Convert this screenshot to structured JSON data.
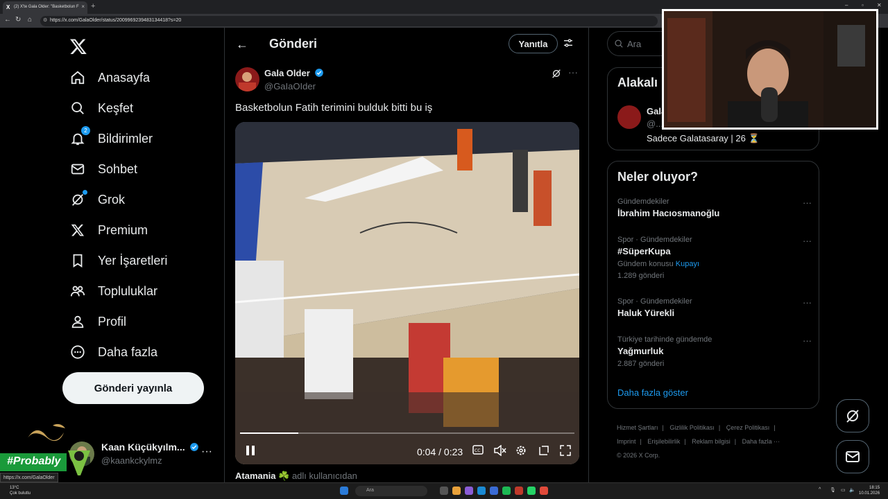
{
  "browser": {
    "tab_title": "(2) X'te Gala Older: \"Basketbolun F",
    "tab_close": "×",
    "new_tab": "+",
    "url": "https://x.com/GalaOlder/status/2009969239483134418?s=20",
    "status_url": "https://x.com/GalaOlder"
  },
  "nav": {
    "items": [
      {
        "label": "Anasayfa",
        "icon": "home-icon"
      },
      {
        "label": "Keşfet",
        "icon": "search-icon"
      },
      {
        "label": "Bildirimler",
        "icon": "bell-icon",
        "badge": "2"
      },
      {
        "label": "Sohbet",
        "icon": "mail-icon"
      },
      {
        "label": "Grok",
        "icon": "grok-icon"
      },
      {
        "label": "Premium",
        "icon": "x-icon"
      },
      {
        "label": "Yer İşaretleri",
        "icon": "bookmark-icon"
      },
      {
        "label": "Topluluklar",
        "icon": "communities-icon"
      },
      {
        "label": "Profil",
        "icon": "profile-icon"
      },
      {
        "label": "Daha fazla",
        "icon": "more-circle-icon"
      }
    ],
    "post_button": "Gönderi yayınla"
  },
  "account": {
    "name": "Kaan Küçükyılm...",
    "handle": "@kaankckylmz",
    "more": "···"
  },
  "overlay": {
    "probably": "#Probably"
  },
  "main": {
    "back": "←",
    "title": "Gönderi",
    "reply_button": "Yanıtla",
    "post": {
      "author_name": "Gala Older",
      "author_handle": "@GaIaOIder",
      "text": "Basketbolun Fatih terimini bulduk bitti bu iş",
      "more": "···",
      "video": {
        "current_time": "0:04",
        "separator": "/",
        "duration": "0:23",
        "progress": 0.174
      }
    },
    "next_post": {
      "name": "Atamania ☘️",
      "suffix": "adlı kullanıcıdan"
    }
  },
  "right": {
    "search_placeholder": "Ara",
    "related": {
      "title": "Alakalı",
      "name": "Gala",
      "handle": "@...",
      "bio": "Sadece Galatasaray | 26 ⏳"
    },
    "trends": {
      "title": "Neler oluyor?",
      "items": [
        {
          "meta": "Gündemdekiler",
          "name": "İbrahim Hacıosmanoğlu",
          "sub": "",
          "link": ""
        },
        {
          "meta": "Spor · Gündemdekiler",
          "name": "#SüperKupa",
          "sub": "Gündem konusu",
          "link": "Kupayı",
          "count": "1.289 gönderi"
        },
        {
          "meta": "Spor · Gündemdekiler",
          "name": "Haluk Yürekli",
          "sub": "",
          "link": ""
        },
        {
          "meta": "Türkiye tarihinde gündemde",
          "name": "Yağmurluk",
          "sub": "2.887 gönderi",
          "link": ""
        }
      ],
      "more_dots": "···",
      "show_more": "Daha fazla göster"
    },
    "footer": {
      "links": [
        "Hizmet Şartları",
        "|",
        "Gizlilik Politikası",
        "|",
        "Çerez Politikası",
        "|",
        "Imprint",
        "|",
        "Erişilebilirlik",
        "|",
        "Reklam bilgisi",
        "|",
        "Daha fazla ···"
      ],
      "copyright": "© 2026 X Corp."
    }
  },
  "taskbar": {
    "temp": "13°C",
    "weather": "Çok bulutlu",
    "search": "Ara",
    "time": "18:15",
    "date": "10.01.2026"
  },
  "colors": {
    "accent": "#1d9bf0",
    "background": "#000000",
    "text": "#e7e9ea",
    "muted": "#71767b",
    "border": "#2f3336"
  }
}
